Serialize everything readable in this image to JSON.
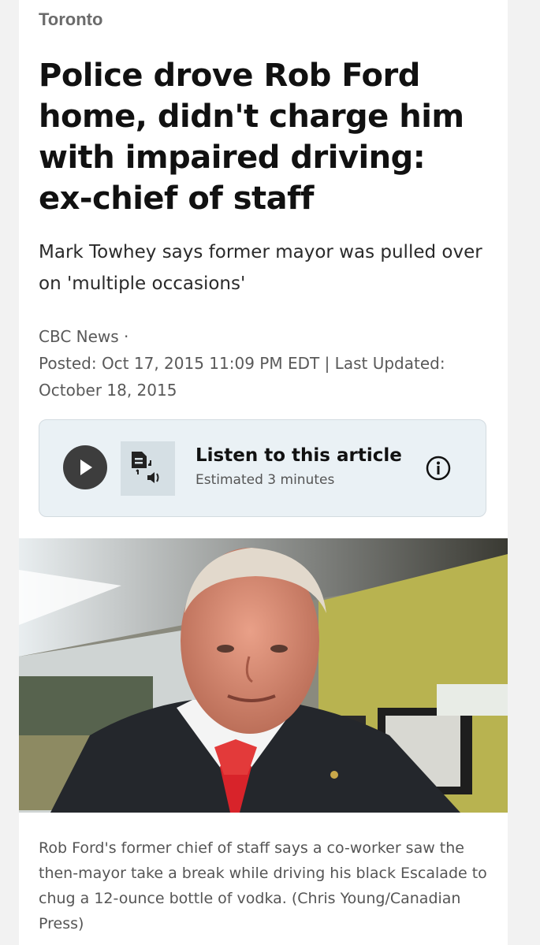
{
  "section": "Toronto",
  "headline": "Police drove Rob Ford home, didn't charge him with impaired driving: ex-chief of staff",
  "deck": "Mark Towhey says former mayor was pulled over on 'multiple occasions'",
  "byline": {
    "source": "CBC News ·",
    "dates": "Posted: Oct 17, 2015 11:09 PM EDT | Last Updated: October 18, 2015"
  },
  "listen": {
    "title": "Listen to this article",
    "subtitle": "Estimated 3 minutes",
    "play_icon": "play-icon",
    "tts_icon": "text-to-speech-icon",
    "info_icon": "info-icon"
  },
  "photo": {
    "caption": "Rob Ford's former chief of staff says a co-worker saw the then-mayor take a break while driving his black Escalade to chug a 12-ounce bottle of vodka. (Chris Young/Canadian Press)"
  }
}
